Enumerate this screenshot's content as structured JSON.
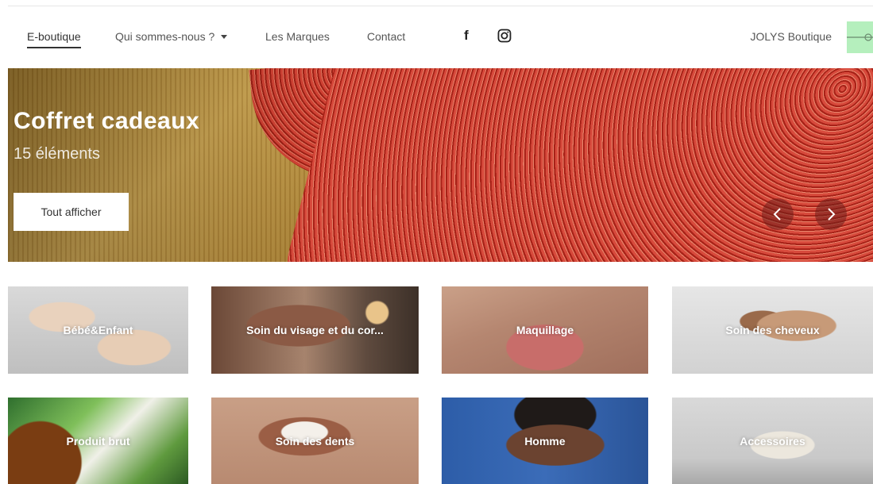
{
  "nav": {
    "items": [
      {
        "label": "E-boutique"
      },
      {
        "label": "Qui sommes-nous ?"
      },
      {
        "label": "Les Marques"
      },
      {
        "label": "Contact"
      }
    ],
    "social": {
      "facebook": "f",
      "instagram_icon": "instagram-icon"
    },
    "brand": "JOLYS Boutique"
  },
  "hero": {
    "title": "Coffret cadeaux",
    "count": "15 éléments",
    "button": "Tout afficher"
  },
  "categories": [
    {
      "label": "Bébé&Enfant"
    },
    {
      "label": "Soin du visage et du cor..."
    },
    {
      "label": "Maquillage"
    },
    {
      "label": "Soin des cheveux"
    },
    {
      "label": "Produit brut"
    },
    {
      "label": "Soin des dents"
    },
    {
      "label": "Homme"
    },
    {
      "label": "Accessoires"
    }
  ],
  "colors": {
    "accent_brand_thumb": "#b5efbd",
    "hero_cloth": "#c23526",
    "text": "#555555"
  }
}
